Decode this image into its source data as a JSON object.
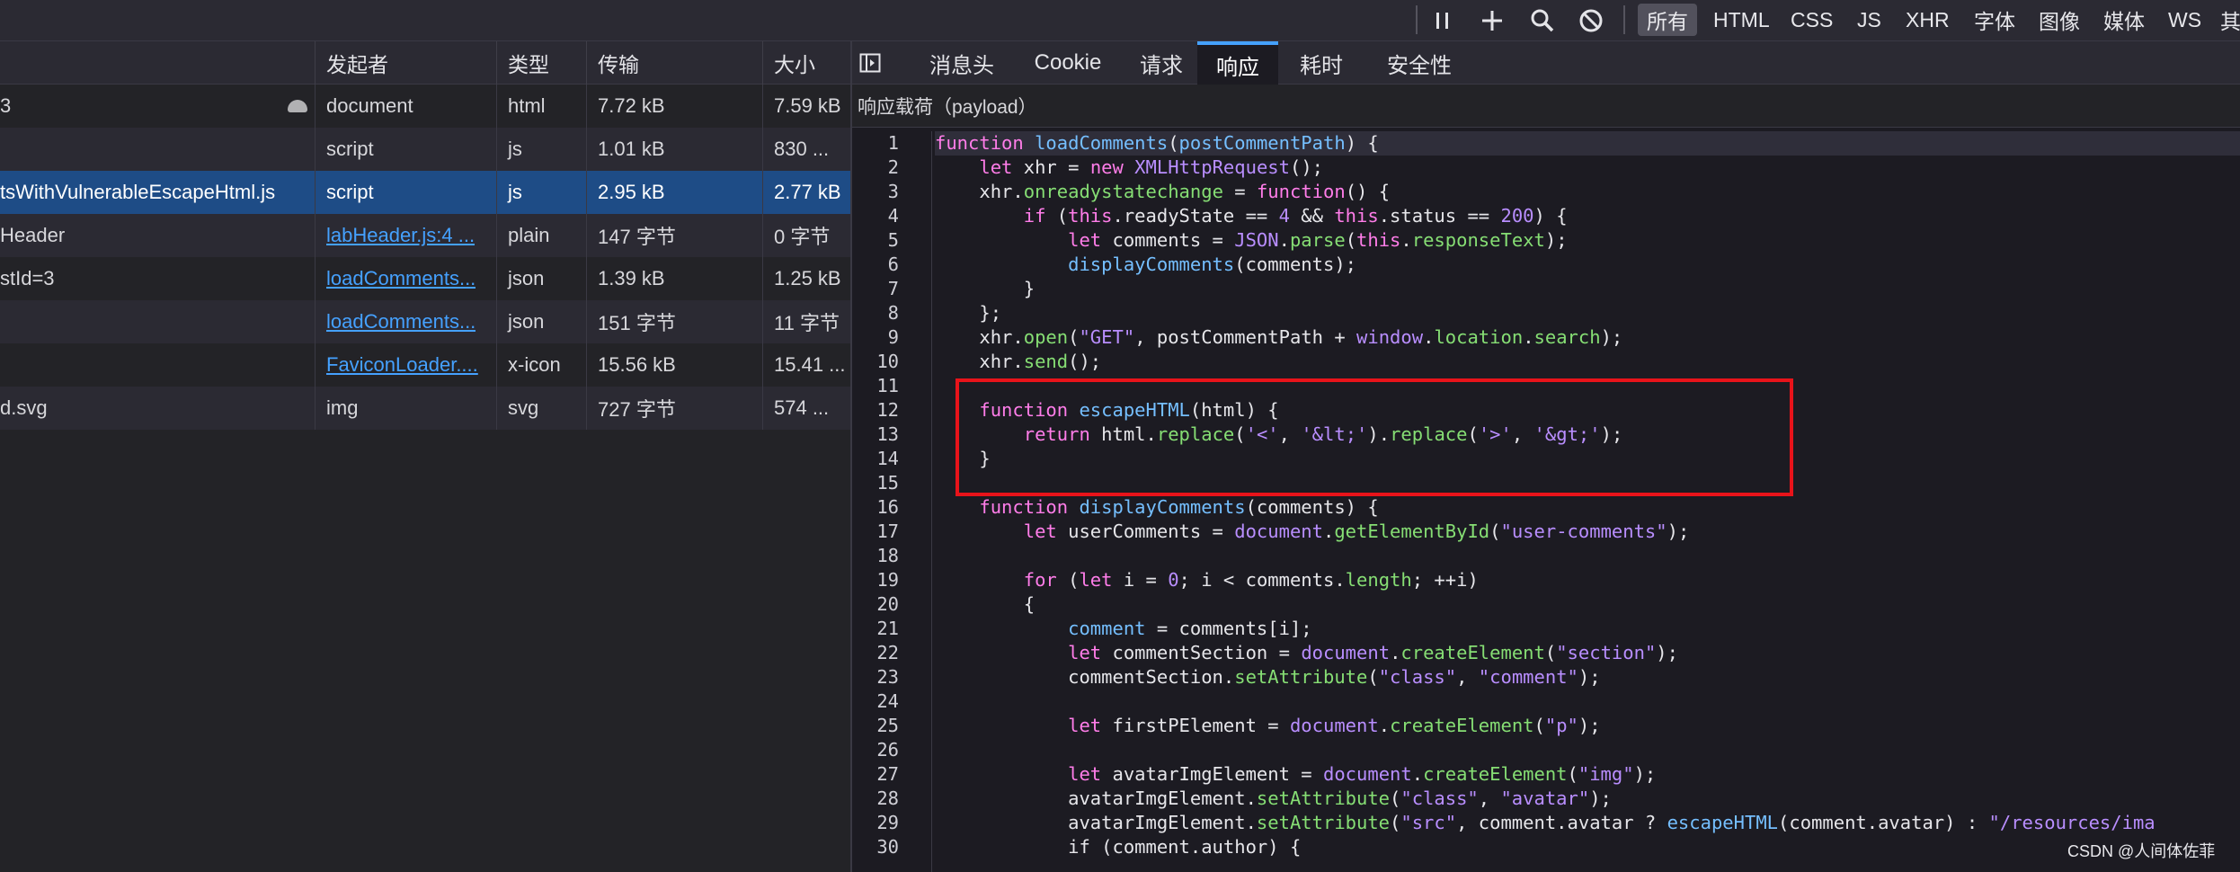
{
  "toolbar": {
    "icons": [
      "pause-icon",
      "plus-icon",
      "search-icon",
      "block-icon"
    ],
    "filters": [
      "所有",
      "HTML",
      "CSS",
      "JS",
      "XHR",
      "字体",
      "图像",
      "媒体",
      "WS",
      "其"
    ],
    "active_filter": "所有"
  },
  "table": {
    "columns": [
      "发起者",
      "类型",
      "传输",
      "大小"
    ],
    "rows": [
      {
        "name": "3",
        "initiator": "document",
        "type": "html",
        "transfer": "7.72 kB",
        "size": "7.59 kB",
        "link": false
      },
      {
        "name": "",
        "initiator": "script",
        "type": "js",
        "transfer": "1.01 kB",
        "size": "830 ...",
        "link": false
      },
      {
        "name": "tsWithVulnerableEscapeHtml.js",
        "initiator": "script",
        "type": "js",
        "transfer": "2.95 kB",
        "size": "2.77 kB",
        "link": false
      },
      {
        "name": "Header",
        "initiator": "labHeader.js:4 ...",
        "type": "plain",
        "transfer": "147 字节",
        "size": "0 字节",
        "link": true
      },
      {
        "name": "stId=3",
        "initiator": "loadComments...",
        "type": "json",
        "transfer": "1.39 kB",
        "size": "1.25 kB",
        "link": true
      },
      {
        "name": "",
        "initiator": "loadComments...",
        "type": "json",
        "transfer": "151 字节",
        "size": "11 字节",
        "link": true
      },
      {
        "name": "",
        "initiator": "FaviconLoader....",
        "type": "x-icon",
        "transfer": "15.56 kB",
        "size": "15.41 ...",
        "link": true
      },
      {
        "name": "d.svg",
        "initiator": "img",
        "type": "svg",
        "transfer": "727 字节",
        "size": "574 ...",
        "link": false
      }
    ]
  },
  "detail": {
    "tabs": [
      "消息头",
      "Cookie",
      "请求",
      "响应",
      "耗时",
      "安全性"
    ],
    "active_tab": "响应",
    "payload_label": "响应载荷（payload）",
    "line_numbers": [
      "1",
      "2",
      "3",
      "4",
      "5",
      "6",
      "7",
      "8",
      "9",
      "10",
      "11",
      "12",
      "13",
      "14",
      "15",
      "16",
      "17",
      "18",
      "19",
      "20",
      "21",
      "22",
      "23",
      "24",
      "25",
      "26",
      "27",
      "28",
      "29",
      "30"
    ]
  },
  "code_text": {
    "l1a": "function",
    "l1b": "loadComments",
    "l1c": "(",
    "l1d": "postCommentPath",
    "l1e": ") {",
    "l2a": "    let",
    "l2b": " xhr = ",
    "l2c": "new",
    "l2d": " XMLHttpRequest",
    "l2e": "();",
    "l3a": "    xhr.",
    "l3b": "onreadystatechange",
    "l3c": " = ",
    "l3d": "function",
    "l3e": "() {",
    "l4a": "        if",
    "l4b": " (",
    "l4c": "this",
    "l4d": ".readyState == ",
    "l4e": "4",
    "l4f": " && ",
    "l4g": "this",
    "l4h": ".status == ",
    "l4i": "200",
    "l4j": ") {",
    "l5a": "            let",
    "l5b": " comments = ",
    "l5c": "JSON",
    "l5d": ".",
    "l5e": "parse",
    "l5f": "(",
    "l5g": "this",
    "l5h": ".",
    "l5i": "responseText",
    "l5j": ");",
    "l6a": "            ",
    "l6b": "displayComments",
    "l6c": "(comments);",
    "l7": "        }",
    "l8": "    };",
    "l9a": "    xhr.",
    "l9b": "open",
    "l9c": "(",
    "l9d": "\"GET\"",
    "l9e": ", postCommentPath + ",
    "l9f": "window",
    "l9g": ".",
    "l9h": "location",
    "l9i": ".",
    "l9j": "search",
    "l9k": ");",
    "l10a": "    xhr.",
    "l10b": "send",
    "l10c": "();",
    "l11": "",
    "l12a": "    function",
    "l12b": " escapeHTML",
    "l12c": "(html) {",
    "l13a": "        return",
    "l13b": " html.",
    "l13c": "replace",
    "l13d": "(",
    "l13e": "'<'",
    "l13f": ", ",
    "l13g": "'&lt;'",
    "l13h": ").",
    "l13i": "replace",
    "l13j": "(",
    "l13k": "'>'",
    "l13l": ", ",
    "l13m": "'&gt;'",
    "l13n": ");",
    "l14": "    }",
    "l15": "",
    "l16a": "    function",
    "l16b": " displayComments",
    "l16c": "(comments) {",
    "l17a": "        let",
    "l17b": " userComments = ",
    "l17c": "document",
    "l17d": ".",
    "l17e": "getElementById",
    "l17f": "(",
    "l17g": "\"user-comments\"",
    "l17h": ");",
    "l18": "",
    "l19a": "        for",
    "l19b": " (",
    "l19c": "let",
    "l19d": " i = ",
    "l19e": "0",
    "l19f": "; i < comments.",
    "l19g": "length",
    "l19h": "; ++i)",
    "l20": "        {",
    "l21a": "            comment",
    "l21b": " = comments[i];",
    "l22a": "            let",
    "l22b": " commentSection = ",
    "l22c": "document",
    "l22d": ".",
    "l22e": "createElement",
    "l22f": "(",
    "l22g": "\"section\"",
    "l22h": ");",
    "l23a": "            commentSection.",
    "l23b": "setAttribute",
    "l23c": "(",
    "l23d": "\"class\"",
    "l23e": ", ",
    "l23f": "\"comment\"",
    "l23g": ");",
    "l24": "",
    "l25a": "            let",
    "l25b": " firstPElement = ",
    "l25c": "document",
    "l25d": ".",
    "l25e": "createElement",
    "l25f": "(",
    "l25g": "\"p\"",
    "l25h": ");",
    "l26": "",
    "l27a": "            let",
    "l27b": " avatarImgElement = ",
    "l27c": "document",
    "l27d": ".",
    "l27e": "createElement",
    "l27f": "(",
    "l27g": "\"img\"",
    "l27h": ");",
    "l28a": "            avatarImgElement.",
    "l28b": "setAttribute",
    "l28c": "(",
    "l28d": "\"class\"",
    "l28e": ", ",
    "l28f": "\"avatar\"",
    "l28g": ");",
    "l29a": "            avatarImgElement.",
    "l29b": "setAttribute",
    "l29c": "(",
    "l29d": "\"src\"",
    "l29e": ", comment.avatar ? ",
    "l29f": "escapeHTML",
    "l29g": "(comment.avatar) : ",
    "l29h": "\"/resources/ima",
    "l30": "            if (comment.author) {"
  },
  "watermark": "CSDN @人间体佐菲",
  "colors": {
    "keyword": "#ff7de9",
    "function": "#75bfff",
    "string": "#b98eff",
    "number": "#86de74",
    "selection": "#1e4c86",
    "link": "#45a1ff",
    "annotation_box": "#e8131a"
  }
}
